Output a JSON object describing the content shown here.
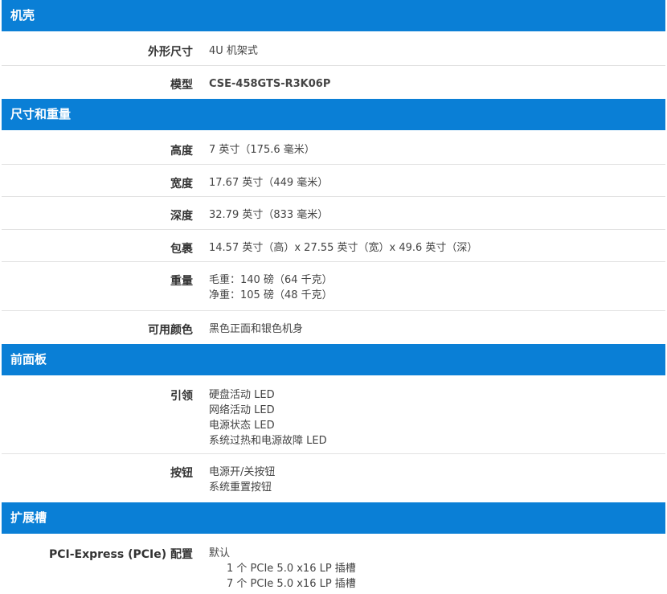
{
  "sections": {
    "chassis": {
      "title": "机壳",
      "form_factor": {
        "label": "外形尺寸",
        "value": "4U 机架式"
      },
      "model": {
        "label": "模型",
        "value": "CSE-458GTS-R3K06P"
      }
    },
    "dimensions": {
      "title": "尺寸和重量",
      "height": {
        "label": "高度",
        "value": "7 英寸（175.6 毫米）"
      },
      "width": {
        "label": "宽度",
        "value": "17.67 英寸（449 毫米）"
      },
      "depth": {
        "label": "深度",
        "value": "32.79 英寸（833 毫米）"
      },
      "package": {
        "label": "包裹",
        "value": "14.57 英寸（高）x 27.55 英寸（宽）x 49.6 英寸（深）"
      },
      "weight": {
        "label": "重量",
        "gross": "毛重：140 磅（64 千克）",
        "net": "净重：105 磅（48 千克）"
      },
      "colors": {
        "label": "可用颜色",
        "value": "黑色正面和银色机身"
      }
    },
    "front_panel": {
      "title": "前面板",
      "leds": {
        "label": "引领",
        "items": [
          "硬盘活动 LED",
          "网络活动 LED",
          "电源状态 LED",
          "系统过热和电源故障 LED"
        ]
      },
      "buttons": {
        "label": "按钮",
        "items": [
          "电源开/关按钮",
          "系统重置按钮"
        ]
      }
    },
    "expansion": {
      "title": "扩展槽",
      "pcie": {
        "label": "PCI-Express (PCIe) 配置",
        "default": "默认",
        "items": [
          "1 个 PCIe 5.0 x16 LP 插槽",
          "7 个 PCIe 5.0 x16 LP 插槽"
        ]
      }
    }
  }
}
